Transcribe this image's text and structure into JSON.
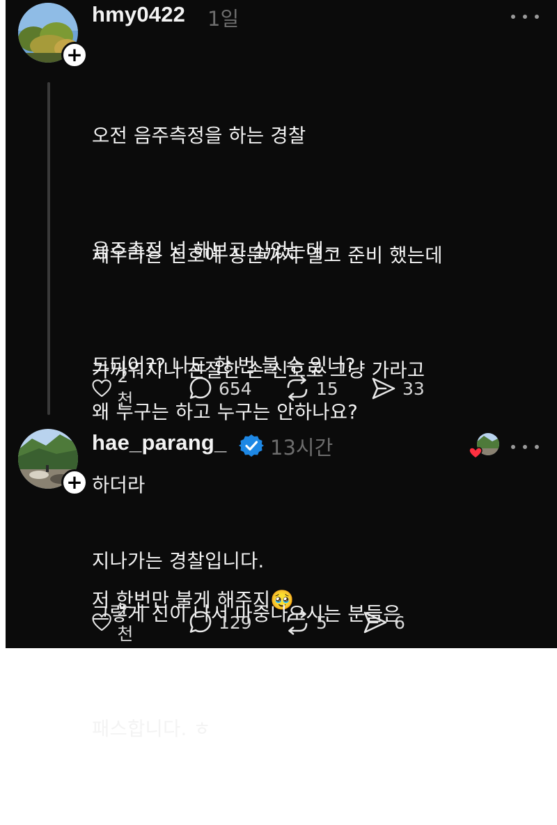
{
  "posts": [
    {
      "username": "hmy0422",
      "time": "1일",
      "verified": false,
      "lines": [
        "오전 음주측정을 하는 경찰",
        "음주측정 넘 해보고 싶었는데~",
        "드디어?? 나도 한 번 불 수 있나?",
        "세우라는 신호에 창문까지 열고 준비 했는데",
        "가까워지니 친절한 손 신호로 그냥 가라고",
        "하더라",
        "저 한번만 불게 해주지🥹",
        "왜 누구는 하고 누구는 안하나요?"
      ],
      "stats": {
        "likes": "2천",
        "comments": "654",
        "reposts": "15",
        "shares": "33"
      }
    },
    {
      "username": "hae_parang_",
      "time": "13시간",
      "verified": true,
      "lines": [
        "지나가는 경찰입니다.",
        "그렇게 신이 나서 마중나오시는 분들은",
        "패스합니다. ㅎ"
      ],
      "stats": {
        "likes": "2천",
        "comments": "129",
        "reposts": "5",
        "shares": "6"
      }
    }
  ],
  "icons": {
    "like": "heart-icon",
    "comment": "speech-bubble-icon",
    "repost": "repost-arrows-icon",
    "share": "send-arrow-icon",
    "more": "more-dots-icon",
    "follow": "plus-icon",
    "verified": "verified-badge-icon"
  },
  "colors": {
    "background": "#0b0b0b",
    "text": "#f3f3f3",
    "muted": "#6d6d6d",
    "verified": "#1e88e5",
    "like_heart": "#ff3040"
  }
}
